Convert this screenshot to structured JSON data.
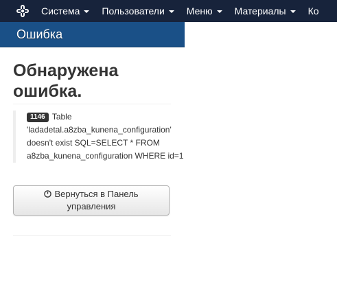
{
  "navbar": {
    "items": [
      {
        "label": "Система"
      },
      {
        "label": "Пользователи"
      },
      {
        "label": "Меню"
      },
      {
        "label": "Материалы"
      },
      {
        "label": "Ко"
      }
    ]
  },
  "subhead": {
    "title": "Ошибка"
  },
  "error": {
    "heading": "Обнаружена ошибка.",
    "code": "1146",
    "message": "Table 'ladadetal.a8zba_kunena_configuration' doesn't exist SQL=SELECT * FROM a8zba_kunena_configuration WHERE id=1"
  },
  "button": {
    "label": "Вернуться в Панель управления"
  },
  "colors": {
    "navbar_bg": "#17233b",
    "subhead_bg": "#1a5087"
  }
}
